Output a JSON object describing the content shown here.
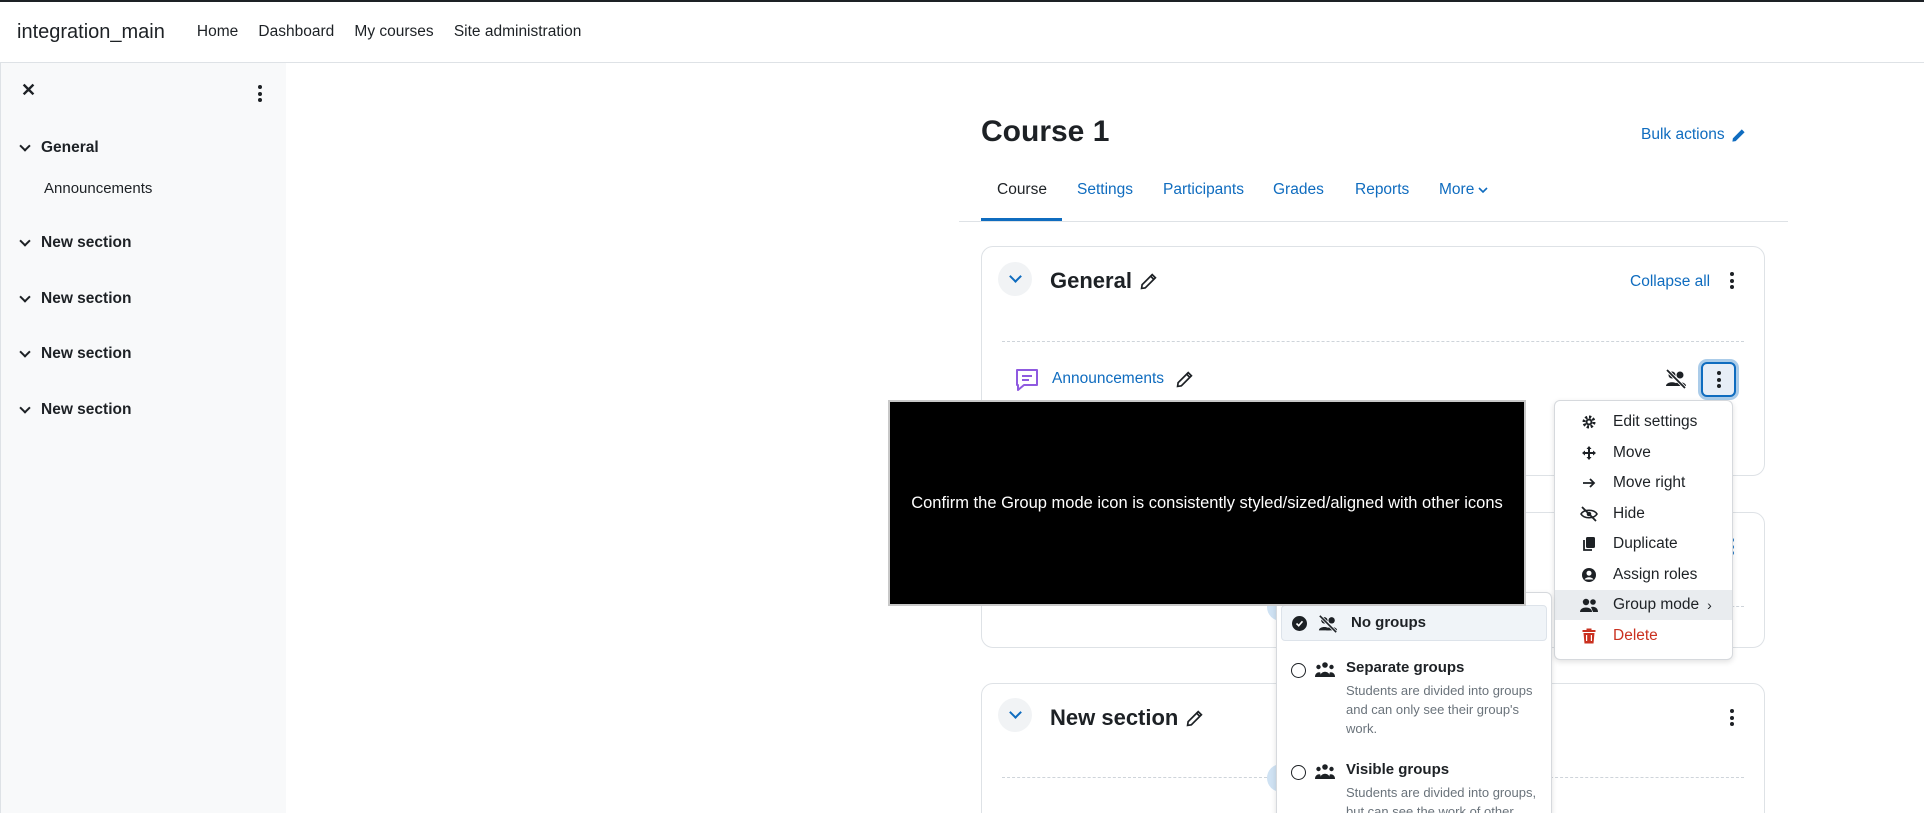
{
  "header": {
    "site_name": "integration_main",
    "nav": [
      "Home",
      "Dashboard",
      "My courses",
      "Site administration"
    ]
  },
  "drawer": {
    "close_icon": "close-icon",
    "sections": [
      {
        "label": "General",
        "items": [
          "Announcements"
        ]
      },
      {
        "label": "New section",
        "items": []
      },
      {
        "label": "New section",
        "items": []
      },
      {
        "label": "New section",
        "items": []
      },
      {
        "label": "New section",
        "items": []
      }
    ]
  },
  "course": {
    "title": "Course 1",
    "bulk_actions": "Bulk actions",
    "tabs": [
      "Course",
      "Settings",
      "Participants",
      "Grades",
      "Reports",
      "More"
    ],
    "active_tab": "Course",
    "collapse_all": "Collapse all"
  },
  "sections": [
    {
      "title": "General",
      "activity": "Announcements"
    },
    {
      "title": "New section"
    }
  ],
  "action_menu": {
    "items": [
      "Edit settings",
      "Move",
      "Move right",
      "Hide",
      "Duplicate",
      "Assign roles",
      "Group mode",
      "Delete"
    ],
    "highlighted": "Group mode"
  },
  "group_mode_menu": {
    "options": [
      {
        "title": "No groups",
        "description": "",
        "selected": true
      },
      {
        "title": "Separate groups",
        "description": "Students are divided into groups and can only see their group's work.",
        "selected": false
      },
      {
        "title": "Visible groups",
        "description": "Students are divided into groups, but can see the work of other",
        "selected": false
      }
    ]
  },
  "overlay": {
    "text": "Confirm the Group mode icon is consistently styled/sized/aligned with other icons"
  },
  "colors": {
    "link": "#0f6cbf",
    "danger": "#ca3120",
    "drawer_bg": "#f8f9fa",
    "forum_icon": "#8f5ae0"
  }
}
